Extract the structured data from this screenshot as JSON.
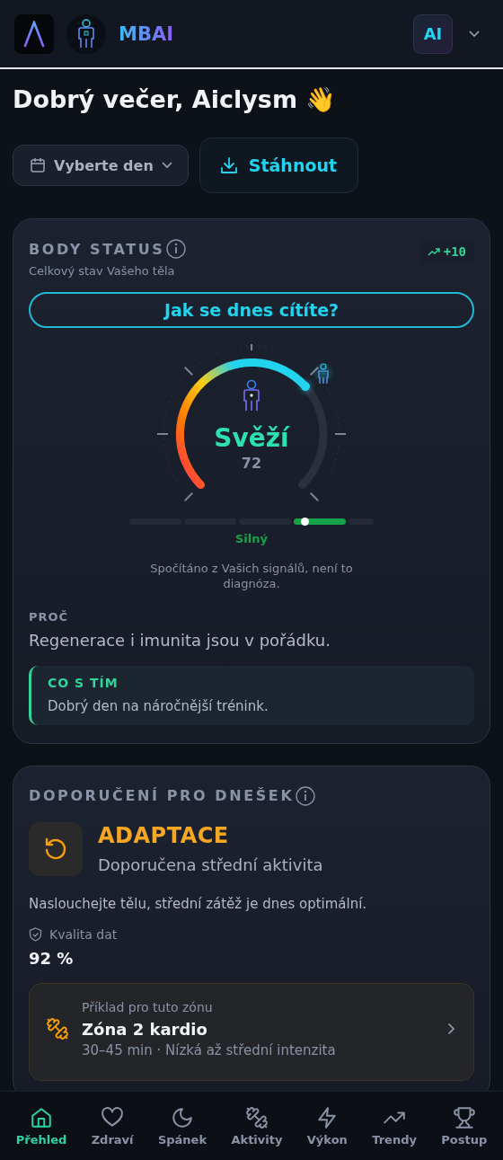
{
  "header": {
    "app_name": "MBAI",
    "avatar_initials": "AI"
  },
  "greeting": "Dobrý večer, Aiclysm 👋",
  "day_picker": {
    "label": "Vyberte den"
  },
  "download_button": {
    "label": "Stáhnout"
  },
  "body_status": {
    "title": "BODY STATUS",
    "subtitle": "Celkový stav Vašeho těla",
    "trend_badge": "+10",
    "feel_button": "Jak se dnes cítíte?",
    "gauge": {
      "state": "Svěží",
      "score": "72"
    },
    "strength": {
      "label": "Silný",
      "segments": [
        {
          "selected": false
        },
        {
          "selected": false
        },
        {
          "selected": false
        },
        {
          "selected": true
        },
        {
          "selected": false
        }
      ]
    },
    "disclaimer": "Spočítáno z Vašich signálů, není to diagnóza.",
    "why_label": "PROČ",
    "why_text": "Regenerace i imunita jsou v pořádku.",
    "action": {
      "title": "CO S TÍM",
      "text": "Dobrý den na náročnější trénink."
    }
  },
  "recommendation": {
    "title": "DOPORUČENÍ PRO DNEŠEK",
    "zone": "ADAPTACE",
    "zone_subtitle": "Doporučena střední aktivita",
    "advice": "Naslouchejte tělu, střední zátěž je dnes optimální.",
    "data_quality_label": "Kvalita dat",
    "data_quality_value": "92 %",
    "example": {
      "caption": "Příklad pro tuto zónu",
      "title": "Zóna 2 kardio",
      "details": "30–45 min · Nízká až střední intenzita"
    }
  },
  "bottom_nav": [
    {
      "label": "Přehled",
      "selected": true
    },
    {
      "label": "Zdraví",
      "selected": false
    },
    {
      "label": "Spánek",
      "selected": false
    },
    {
      "label": "Aktivity",
      "selected": false
    },
    {
      "label": "Výkon",
      "selected": false
    },
    {
      "label": "Trendy",
      "selected": false
    },
    {
      "label": "Postup",
      "selected": false
    }
  ]
}
